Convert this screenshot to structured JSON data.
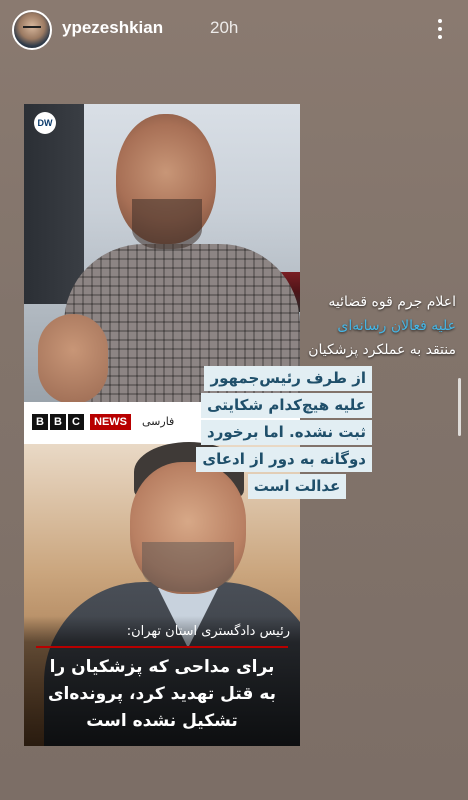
{
  "header": {
    "username": "ypezeshkian",
    "timestamp": "20h",
    "more_label": "more options"
  },
  "dw_card": {
    "logo": "DW",
    "caption_lines": [
      "اعلام جرم قوه قضائیه",
      "علیه فعالان رسانه‌ای",
      "منتقد به عملکرد پزشکیان"
    ]
  },
  "bbc_card": {
    "logo_letters": [
      "B",
      "B",
      "C"
    ],
    "news_label": "NEWS",
    "language_label": "فارسی",
    "caption_title": "رئیس دادگستری استان تهران:",
    "caption_lines": [
      "برای مداحی که پزشکیان را",
      "به قتل تهدید کرد، پرونده‌ای",
      "تشکیل نشده است"
    ]
  },
  "sticker": {
    "lines": [
      "از طرف رئیس‌جمهور",
      "علیه هیچ‌کدام شکایتی",
      "ثبت نشده. اما برخورد",
      "دوگانه به دور از ادعای",
      "عدالت است"
    ]
  },
  "colors": {
    "background": "#82746b",
    "dw_highlight": "#45b6e6",
    "bbc_red": "#b80000",
    "sticker_bg": "#e2eef3",
    "sticker_text": "#1f4f6a"
  }
}
